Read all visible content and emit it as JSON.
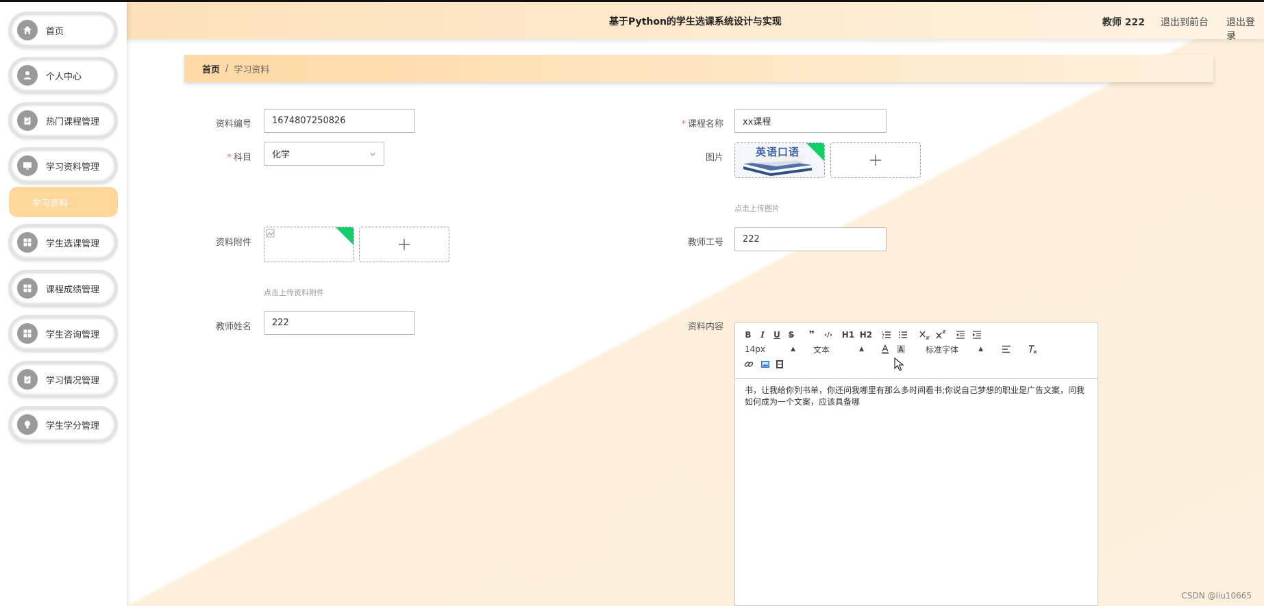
{
  "header": {
    "title": "基于Python的学生选课系统设计与实现",
    "user": "教师 222",
    "link_front": "退出到前台",
    "link_logout": "退出登录"
  },
  "sidebar": {
    "items": [
      {
        "label": "首页",
        "icon": "home-icon"
      },
      {
        "label": "个人中心",
        "icon": "user-icon"
      },
      {
        "label": "热门课程管理",
        "icon": "clipboard-icon"
      },
      {
        "label": "学习资料管理",
        "icon": "monitor-icon"
      },
      {
        "label": "学生选课管理",
        "icon": "grid-icon"
      },
      {
        "label": "课程成绩管理",
        "icon": "grid-icon"
      },
      {
        "label": "学生咨询管理",
        "icon": "grid-icon"
      },
      {
        "label": "学习情况管理",
        "icon": "clipboard-icon"
      },
      {
        "label": "学生学分管理",
        "icon": "bulb-icon"
      }
    ],
    "active_sub": "学习资料"
  },
  "breadcrumb": {
    "home": "首页",
    "sep": "/",
    "current": "学习资料"
  },
  "form": {
    "code_label": "资料编号",
    "code_value": "1674807250826",
    "course_label": "课程名称",
    "course_value": "xx课程",
    "subject_label": "科目",
    "subject_value": "化学",
    "image_label": "图片",
    "image_thumb_text": "英语口语",
    "image_tip": "点击上传图片",
    "attachment_label": "资料附件",
    "attachment_tip": "点击上传资料附件",
    "teacher_no_label": "教师工号",
    "teacher_no_value": "222",
    "teacher_name_label": "教师姓名",
    "teacher_name_value": "222",
    "content_label": "资料内容",
    "required_mark": "*"
  },
  "editor": {
    "bold": "B",
    "italic": "I",
    "underline": "U",
    "strike": "S",
    "quote": "❞",
    "code": "‹/›",
    "h1": "H1",
    "h2": "H2",
    "size": "14px",
    "text": "文本",
    "font": "标准字体",
    "content": "书，让我给你列书单，你还问我哪里有那么多时间看书;你说自己梦想的职业是广告文案，问我如何成为一个文案，应该具备哪"
  },
  "watermark": "CSDN @liu10665",
  "colors": {
    "accent": "#ffd79b",
    "header_start": "#fde0b8",
    "required": "#f56c6c",
    "upload_badge": "#13ce66"
  }
}
